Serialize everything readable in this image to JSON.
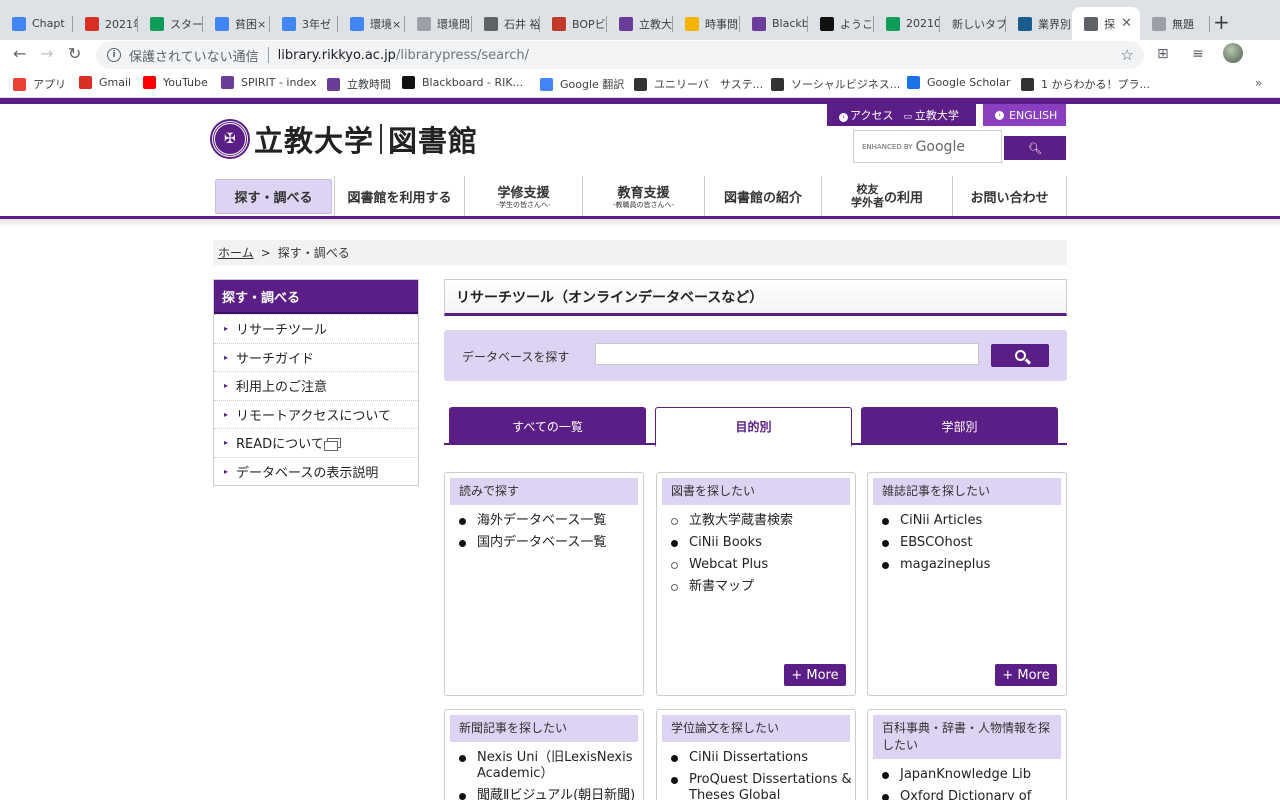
{
  "browser": {
    "tabs": [
      {
        "label": "Chapt",
        "icon": "google-docs-icon",
        "color": "#4285f4"
      },
      {
        "label": "2021年",
        "icon": "gmail-icon",
        "color": "#d93025"
      },
      {
        "label": "スター",
        "icon": "google-drive-icon",
        "color": "#0f9d58"
      },
      {
        "label": "貧困×",
        "icon": "google-docs-icon",
        "color": "#4285f4"
      },
      {
        "label": "3年ゼ",
        "icon": "google-docs-icon",
        "color": "#4285f4"
      },
      {
        "label": "環境×",
        "icon": "google-docs-icon",
        "color": "#4285f4"
      },
      {
        "label": "環境問",
        "icon": "doc-file-icon",
        "color": "#9aa0a6"
      },
      {
        "label": "石井 裕",
        "icon": "pdf-icon",
        "color": "#5f6368"
      },
      {
        "label": "BOPビ",
        "icon": "red-arch-icon",
        "color": "#c0392b"
      },
      {
        "label": "立教大",
        "icon": "rikkyo-icon",
        "color": "#6a3d9a"
      },
      {
        "label": "時事問",
        "icon": "google-slides-icon",
        "color": "#f4b400"
      },
      {
        "label": "Blackb",
        "icon": "rikkyo-icon",
        "color": "#6a3d9a"
      },
      {
        "label": "ようこ",
        "icon": "blackboard-icon",
        "color": "#111111"
      },
      {
        "label": "20210",
        "icon": "google-drive-icon",
        "color": "#0f9d58"
      },
      {
        "label": "新しいタブ",
        "icon": "",
        "color": ""
      },
      {
        "label": "業界別",
        "icon": "s-site-icon",
        "color": "#1a5c8e"
      },
      {
        "label": "探",
        "icon": "globe-icon",
        "color": "#5f6368"
      },
      {
        "label": "無題",
        "icon": "loading-icon",
        "color": "#9aa0a6"
      }
    ],
    "omnibox": {
      "security_text": "保護されていない通信",
      "host": "library.rikkyo.ac.jp",
      "path": "/librarypress/search/"
    },
    "bookmarks": [
      {
        "label": "アプリ",
        "icon": "apps-grid-icon"
      },
      {
        "label": "Gmail",
        "icon": "gmail-icon"
      },
      {
        "label": "YouTube",
        "icon": "youtube-icon"
      },
      {
        "label": "SPIRIT - index",
        "icon": "rikkyo-icon"
      },
      {
        "label": "立教時間",
        "icon": "rikkyo-icon"
      },
      {
        "label": "Blackboard - RIK...",
        "icon": "blackboard-icon"
      },
      {
        "label": "Google 翻訳",
        "icon": "google-translate-icon"
      },
      {
        "label": "ユニリーバ　サステ...",
        "icon": "unilever-icon"
      },
      {
        "label": "ソーシャルビジネス...",
        "icon": "unilever-icon"
      },
      {
        "label": "Google Scholar",
        "icon": "scholar-icon"
      },
      {
        "label": "1 からわかる！プラ...",
        "icon": "n-icon"
      }
    ]
  },
  "site": {
    "logo_text_left": "立教大学",
    "logo_text_right": "図書館",
    "access_label": "アクセス",
    "university_link": "立教大学",
    "english_label": "ENGLISH",
    "google_enhanced": "ENHANCED BY",
    "google_word": "Google"
  },
  "gnav": [
    {
      "label": "探す・調べる",
      "sub": ""
    },
    {
      "label": "図書館を利用する",
      "sub": ""
    },
    {
      "label": "学修支援",
      "sub": "-学生の皆さんへ-"
    },
    {
      "label": "教育支援",
      "sub": "-教職員の皆さんへ-"
    },
    {
      "label": "図書館の紹介",
      "sub": ""
    },
    {
      "label": "学外者",
      "sub": "校友",
      "suffix": "の利用"
    },
    {
      "label": "お問い合わせ",
      "sub": ""
    }
  ],
  "breadcrumb": {
    "home": "ホーム",
    "sep": ">",
    "current": "探す・調べる"
  },
  "sidebar": {
    "title": "探す・調べる",
    "items": [
      {
        "label": "リサーチツール"
      },
      {
        "label": "サーチガイド"
      },
      {
        "label": "利用上のご注意"
      },
      {
        "label": "リモートアクセスについて"
      },
      {
        "label": "READについて"
      },
      {
        "label": "データベースの表示説明"
      }
    ]
  },
  "main": {
    "title": "リサーチツール（オンラインデータベースなど）",
    "db_search_label": "データベースを探す",
    "db_search_value": "",
    "tabs": [
      {
        "label": "すべての一覧"
      },
      {
        "label": "目的別"
      },
      {
        "label": "学部別"
      }
    ],
    "more_label": "+ More",
    "cards": [
      {
        "title": "読みで探す",
        "items": [
          {
            "label": "海外データベース一覧",
            "bullet": "filled"
          },
          {
            "label": "国内データベース一覧",
            "bullet": "filled"
          }
        ]
      },
      {
        "title": "図書を探したい",
        "items": [
          {
            "label": "立教大学蔵書検索",
            "bullet": "open"
          },
          {
            "label": "CiNii Books",
            "bullet": "filled"
          },
          {
            "label": "Webcat Plus",
            "bullet": "open"
          },
          {
            "label": "新書マップ",
            "bullet": "open"
          }
        ]
      },
      {
        "title": "雑誌記事を探したい",
        "items": [
          {
            "label": "CiNii Articles",
            "bullet": "filled"
          },
          {
            "label": "EBSCOhost",
            "bullet": "filled"
          },
          {
            "label": "magazineplus",
            "bullet": "filled"
          }
        ]
      },
      {
        "title": "新聞記事を探したい",
        "items": [
          {
            "label": "Nexis Uni（旧LexisNexis Academic）",
            "bullet": "filled"
          },
          {
            "label": "聞蔵Ⅱビジュアル(朝日新聞)",
            "bullet": "filled"
          }
        ]
      },
      {
        "title": "学位論文を探したい",
        "items": [
          {
            "label": "CiNii Dissertations",
            "bullet": "filled"
          },
          {
            "label": "ProQuest Dissertations & Theses Global",
            "bullet": "filled"
          }
        ]
      },
      {
        "title": "百科事典・辞書・人物情報を探したい",
        "items": [
          {
            "label": "JapanKnowledge Lib",
            "bullet": "filled"
          },
          {
            "label": "Oxford Dictionary of",
            "bullet": "filled"
          }
        ]
      }
    ]
  },
  "colors": {
    "brand_purple": "#5a1e86",
    "light_purple": "#ddd3f3"
  }
}
